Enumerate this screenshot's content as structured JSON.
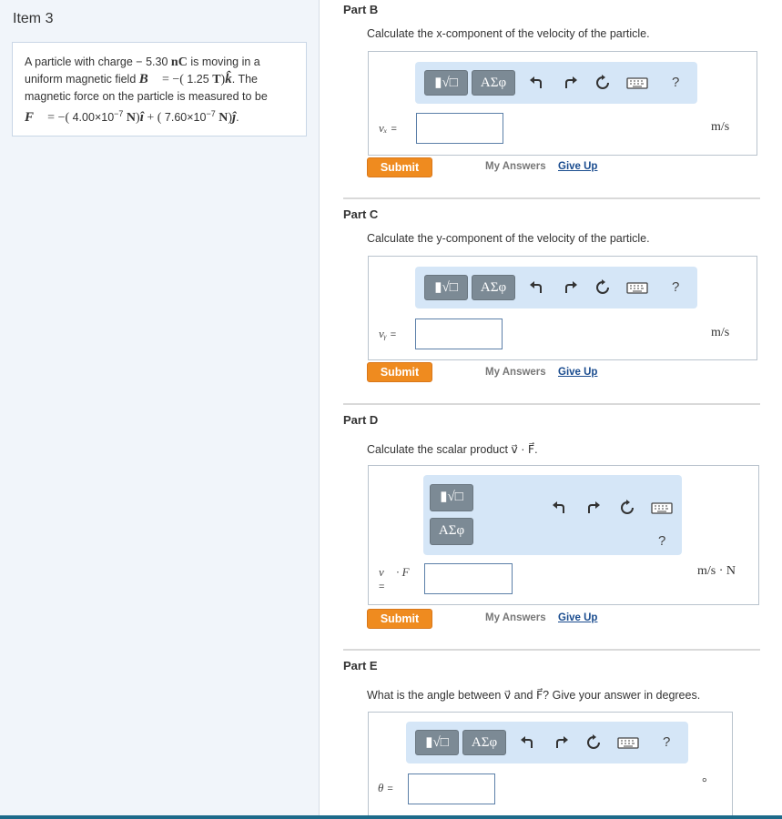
{
  "item": {
    "title": "Item 3",
    "problem": {
      "t1": "A particle with charge",
      "charge_sign": "−",
      "charge_value": "5.30",
      "charge_unit": "nC",
      "t2": "is moving in a",
      "t3": "uniform magnetic field",
      "b_vec": "B⃗",
      "b_eq": "= −(",
      "b_value": "1.25",
      "b_unit": "T",
      "b_close": ")",
      "k_hat": "k̂",
      "t4": ". The",
      "t5": "magnetic force on the particle is measured to be",
      "f_vec": "F⃗",
      "f_eq": "= −(",
      "fx_value": "4.00×10",
      "fx_exp": "−7",
      "fx_unit": "N",
      "fx_close": ")",
      "i_hat": "î",
      "plus": "+ (",
      "fy_value": "7.60×10",
      "fy_exp": "−7",
      "fy_unit": "N",
      "fy_close": ")",
      "j_hat": "ĵ",
      "period": "."
    }
  },
  "toolbar": {
    "templates_label": "▮√□",
    "symbols_label": "ΑΣφ",
    "help_label": "?"
  },
  "parts": [
    {
      "heading": "Part B",
      "question": "Calculate the x-component of the velocity of the particle.",
      "var_label": "vₓ",
      "eq": "=",
      "unit": "m/s",
      "submit": "Submit",
      "my_answers": "My Answers",
      "give_up": "Give Up"
    },
    {
      "heading": "Part C",
      "question": "Calculate the y-component of the velocity of the particle.",
      "var_label": "vᵧ",
      "eq": "=",
      "unit": "m/s",
      "submit": "Submit",
      "my_answers": "My Answers",
      "give_up": "Give Up"
    },
    {
      "heading": "Part D",
      "question": "Calculate the scalar product v⃗ · F⃗.",
      "var_label": "v⃗ · F⃗",
      "eq": "=",
      "unit": "m/s · N",
      "submit": "Submit",
      "my_answers": "My Answers",
      "give_up": "Give Up"
    },
    {
      "heading": "Part E",
      "question": "What is the angle between v⃗ and F⃗? Give your answer in degrees.",
      "var_label": "θ",
      "eq": "=",
      "unit": "°"
    }
  ],
  "colors": {
    "submit": "#ef8b1f",
    "toolbar_bg": "#d5e6f7",
    "toolbar_button": "#7c8a95",
    "link": "#1a4c8f",
    "left_pane_bg": "#f1f5fa"
  }
}
